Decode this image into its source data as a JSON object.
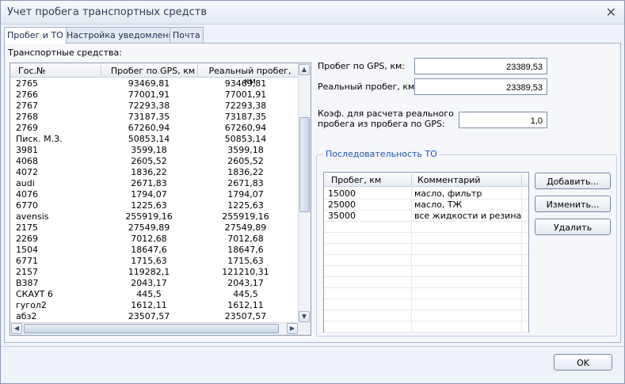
{
  "window": {
    "title": "Учет пробега транспортных средств"
  },
  "tabs": [
    {
      "label": "Пробег и ТО"
    },
    {
      "label": "Настройка уведомлений"
    },
    {
      "label": "Почта"
    }
  ],
  "vehicles": {
    "label": "Транспортные средства:",
    "columns": [
      "Гос.№",
      "Пробег по GPS, км",
      "Реальный пробег, км"
    ],
    "rows": [
      [
        "2765",
        "93469,81",
        "93469,81"
      ],
      [
        "2766",
        "77001,91",
        "77001,91"
      ],
      [
        "2767",
        "72293,38",
        "72293,38"
      ],
      [
        "2768",
        "73187,35",
        "73187,35"
      ],
      [
        "2769",
        "67260,94",
        "67260,94"
      ],
      [
        "Писк. М.З.",
        "50853,14",
        "50853,14"
      ],
      [
        "3981",
        "3599,18",
        "3599,18"
      ],
      [
        "4068",
        "2605,52",
        "2605,52"
      ],
      [
        "4072",
        "1836,22",
        "1836,22"
      ],
      [
        "audi",
        "2671,83",
        "2671,83"
      ],
      [
        "4076",
        "1794,07",
        "1794,07"
      ],
      [
        "6770",
        "1225,63",
        "1225,63"
      ],
      [
        "avensis",
        "255919,16",
        "255919,16"
      ],
      [
        "2175",
        "27549,89",
        "27549,89"
      ],
      [
        "2269",
        "7012,68",
        "7012,68"
      ],
      [
        "1504",
        "18647,6",
        "18647,6"
      ],
      [
        "6771",
        "1715,63",
        "1715,63"
      ],
      [
        "2157",
        "119282,1",
        "121210,31"
      ],
      [
        "В387",
        "2043,17",
        "2043,17"
      ],
      [
        "СКАУТ 6",
        "445,5",
        "445,5"
      ],
      [
        "гугол2",
        "1612,11",
        "1612,11"
      ],
      [
        "абз2",
        "23507,57",
        "23507,57"
      ]
    ]
  },
  "fields": {
    "gps_label": "Пробег по GPS, км:",
    "gps_value": "23389,53",
    "real_label": "Реальный пробег, км:",
    "real_value": "23389,53",
    "coef_label_1": "Коэф. для расчета реального",
    "coef_label_2": "пробега из пробега по GPS:",
    "coef_value": "1,0"
  },
  "maintenance": {
    "title": "Последовательность ТО",
    "columns": [
      "Пробег, км",
      "Комментарий"
    ],
    "rows": [
      [
        "15000",
        "масло, фильтр"
      ],
      [
        "25000",
        "масло, ТЖ"
      ],
      [
        "35000",
        "все жидкости и резина"
      ]
    ],
    "add_label": "Добавить...",
    "edit_label": "Изменить...",
    "delete_label": "Удалить"
  },
  "footer": {
    "ok_label": "OK"
  },
  "icons": {
    "close": "close-icon",
    "scroll_up": "scroll-up-arrow-icon",
    "scroll_down": "scroll-down-arrow-icon",
    "scroll_left": "scroll-left-arrow-icon",
    "scroll_right": "scroll-right-arrow-icon"
  }
}
